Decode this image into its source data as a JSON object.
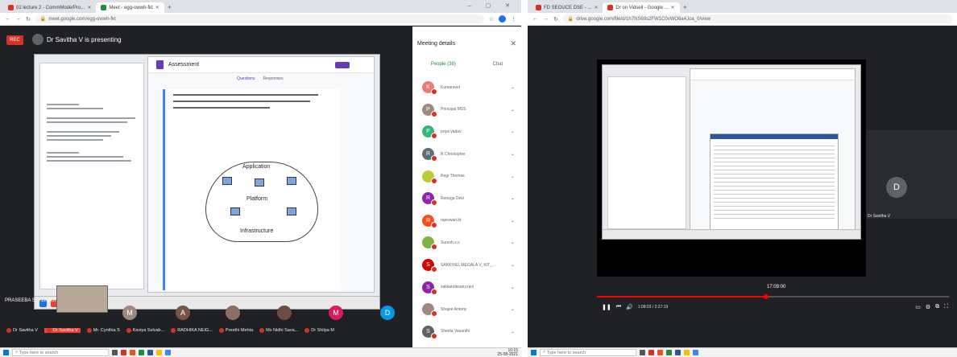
{
  "left": {
    "tabs": [
      {
        "label": "02 lecture 2 - CommMode/Pro...",
        "active": false
      },
      {
        "label": "Meet - egg-owwh-fkt",
        "active": true
      }
    ],
    "url": "meet.google.com/egg-owwh-fkt",
    "rec_label": "REC",
    "presenter_label": "Dr Savitha V is presenting",
    "form": {
      "title": "Assessment",
      "tab_questions": "Questions",
      "tab_responses": "Responses",
      "diagram_application": "Application",
      "diagram_platform": "Platform",
      "diagram_infrastructure": "Infrastructure"
    },
    "panel": {
      "title": "Meeting details",
      "close": "✕",
      "tab_people": "People (36)",
      "tab_chat": "Chat",
      "participants": [
        {
          "initial": "K",
          "name": "Kumaravel",
          "color": "#e67c73"
        },
        {
          "initial": "P",
          "name": "Principal MSS",
          "color": "#a1887f"
        },
        {
          "initial": "P",
          "name": "priya yadav",
          "color": "#33b679"
        },
        {
          "initial": "R",
          "name": "R Christopher",
          "color": "#5f6d7a"
        },
        {
          "initial": "",
          "name": "Regi Thomas",
          "color": "#c0ca33"
        },
        {
          "initial": "R",
          "name": "Renuga Devi",
          "color": "#8e24aa"
        },
        {
          "initial": "R",
          "name": "rajeswari.kt",
          "color": "#f4511e"
        },
        {
          "initial": "",
          "name": "Suresh.s.s",
          "color": "#7cb342"
        },
        {
          "initial": "S",
          "name": "SAKKIVEL MEGALA V_KIT_...",
          "color": "#d50000"
        },
        {
          "initial": "S",
          "name": "sakkandasany.ravi",
          "color": "#8e24aa"
        },
        {
          "initial": "",
          "name": "Shajee Antony",
          "color": "#a1887f"
        },
        {
          "initial": "S",
          "name": "Sheela Vasanthi",
          "color": "#616161"
        }
      ]
    },
    "selfview_notice": "PRASEEBA S F 12045042 has left the meeting",
    "tiles": [
      {
        "initial": "M",
        "color": "#a1887f"
      },
      {
        "initial": "A",
        "color": "#795548"
      },
      {
        "initial": "",
        "color": "#8d6e63"
      },
      {
        "initial": "",
        "color": "#6d4c41"
      },
      {
        "initial": "M",
        "color": "#d81b60"
      },
      {
        "initial": "D",
        "color": "#039be5"
      }
    ],
    "names": [
      "Dr Savitha V",
      "Dr Savitha V",
      "Mr. Cynthia S",
      "Kaviya Selvab...",
      "RADHIKA NEIG...",
      "Preethi Mehta",
      "Ms Nidhi Sava...",
      "Dr Shilpa M"
    ],
    "taskbar_search": "Type here to search",
    "clock": "10:15\n25-08-2021"
  },
  "right": {
    "tabs": [
      {
        "label": "FD SEOUCE DSE - ...",
        "active": false
      },
      {
        "label": "Dr on Vidseil - Google ...",
        "active": true
      }
    ],
    "url": "drive.google.com/file/d/1h7NS69s2FW1C0vWO6a4Joa_0/view",
    "tile_initial": "D",
    "tile_name": "Dr Savitha V",
    "time_popup": "17:09:00",
    "time_display": "1:08:03 / 2:27:19",
    "progress": 0.48,
    "taskbar_search": "Type here to search"
  }
}
